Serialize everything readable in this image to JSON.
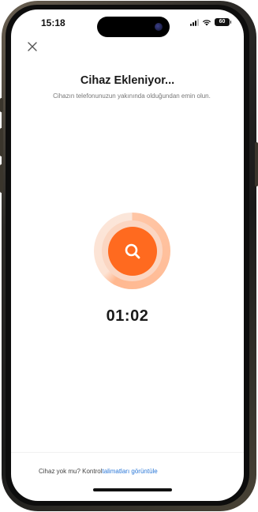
{
  "status_bar": {
    "time": "15:18",
    "battery": "60",
    "icons": [
      "signal-icon",
      "wifi-icon",
      "battery-icon"
    ]
  },
  "header": {
    "close_icon": "close-icon",
    "title": "Cihaz Ekleniyor...",
    "subtitle": "Cihazın telefonunuzun yakınında olduğundan emin olun."
  },
  "search": {
    "icon": "search-icon",
    "accent_color": "#ff6a1f",
    "timer": "01:02"
  },
  "footer": {
    "prompt": "Cihaz yok mu? Kontrol",
    "link": "talimatları görüntüle",
    "link_color": "#2b78d8"
  }
}
